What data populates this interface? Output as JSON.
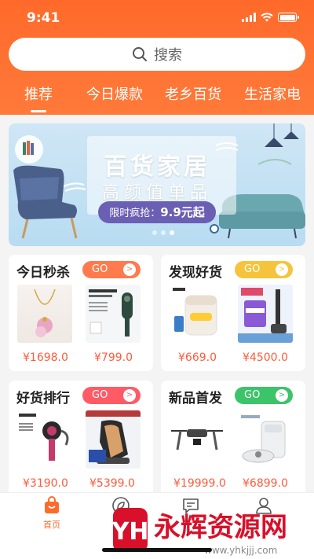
{
  "status_bar": {
    "time": "9:41"
  },
  "search": {
    "placeholder": "搜索"
  },
  "tabs": [
    "推荐",
    "今日爆款",
    "老乡百货",
    "生活家电"
  ],
  "banner": {
    "title": "百货家居",
    "subtitle": "高颜值单品",
    "promo_label": "限时疯抢：",
    "promo_price": "9.9元起"
  },
  "cards": [
    {
      "title": "今日秒杀",
      "go": "GO",
      "go_color": "#ff7a4d",
      "prices": [
        "¥1698.0",
        "¥799.0"
      ]
    },
    {
      "title": "发现好货",
      "go": "GO",
      "go_color": "#f5c43c",
      "prices": [
        "¥669.0",
        "¥4500.0"
      ]
    },
    {
      "title": "好货排行",
      "go": "GO",
      "go_color": "#ff5b66",
      "prices": [
        "¥3190.0",
        "¥5399.0"
      ]
    },
    {
      "title": "新品首发",
      "go": "GO",
      "go_color": "#3cc46a",
      "prices": [
        "¥19999.0",
        "¥6899.0"
      ]
    }
  ],
  "tabbar": {
    "items": [
      "首页",
      "生活",
      "",
      ""
    ],
    "active_color": "#ff6a2a"
  },
  "watermark": {
    "text": "永辉资源网",
    "url": "www.yhkjjj.com"
  },
  "colors": {
    "brand": "#ff6a2a",
    "price": "#ff5a3c"
  }
}
